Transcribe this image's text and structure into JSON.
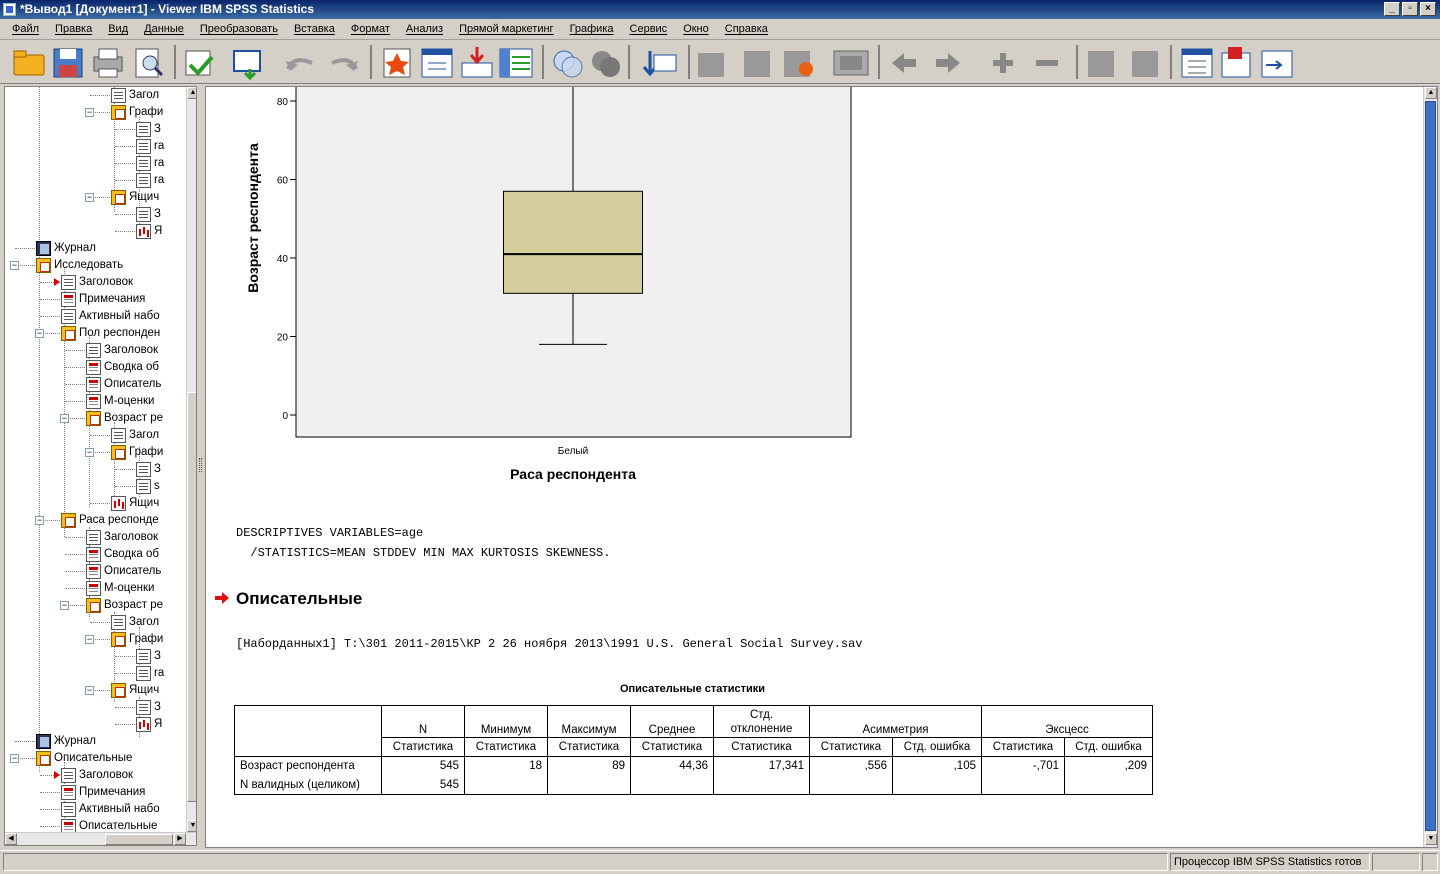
{
  "window": {
    "title": "*Вывод1 [Документ1] - Viewer IBM SPSS Statistics"
  },
  "menu": [
    "Файл",
    "Правка",
    "Вид",
    "Данные",
    "Преобразовать",
    "Вставка",
    "Формат",
    "Анализ",
    "Прямой маркетинг",
    "Графика",
    "Сервис",
    "Окно",
    "Справка"
  ],
  "toolbar": {
    "icons": [
      "open-icon",
      "save-icon",
      "print-icon",
      "print-preview-icon",
      "export-icon",
      "recall-dialog-icon",
      "undo-icon",
      "redo-icon",
      "goto-data-icon",
      "goto-case-icon",
      "goto-variable-icon",
      "variables-icon",
      "show-all-icon",
      "hide-icon",
      "designate-window-icon",
      "promote-icon",
      "demote-icon",
      "expand-icon",
      "collapse-icon",
      "show-icon",
      "hide-item-icon",
      "insert-heading-icon",
      "insert-title-icon",
      "insert-text-icon"
    ]
  },
  "outline": {
    "items": [
      {
        "label": "Загол",
        "y": 5,
        "indent": 110,
        "icon": "doc",
        "line": true
      },
      {
        "label": "Графи",
        "y": 22,
        "indent": 110,
        "icon": "folder",
        "pm": "-"
      },
      {
        "label": "З",
        "y": 39,
        "indent": 135,
        "icon": "doc"
      },
      {
        "label": "ra",
        "y": 56,
        "indent": 135,
        "icon": "doc"
      },
      {
        "label": "ra",
        "y": 73,
        "indent": 135,
        "icon": "doc"
      },
      {
        "label": "ra",
        "y": 90,
        "indent": 135,
        "icon": "doc"
      },
      {
        "label": "Ящич",
        "y": 107,
        "indent": 110,
        "icon": "folder",
        "pm": "-"
      },
      {
        "label": "З",
        "y": 124,
        "indent": 135,
        "icon": "doc"
      },
      {
        "label": "Я",
        "y": 141,
        "indent": 135,
        "icon": "chart"
      },
      {
        "label": "Журнал",
        "y": 158,
        "indent": 35,
        "icon": "book"
      },
      {
        "label": "Исследовать",
        "y": 175,
        "indent": 35,
        "icon": "folder",
        "pm": "-"
      },
      {
        "label": "Заголовок",
        "y": 192,
        "indent": 60,
        "icon": "doc",
        "arrow": true
      },
      {
        "label": "Примечания",
        "y": 209,
        "indent": 60,
        "icon": "table"
      },
      {
        "label": "Активный набо",
        "y": 226,
        "indent": 60,
        "icon": "doc"
      },
      {
        "label": "Пол респонден",
        "y": 243,
        "indent": 60,
        "icon": "folder",
        "pm": "-"
      },
      {
        "label": "Заголовок",
        "y": 260,
        "indent": 85,
        "icon": "doc"
      },
      {
        "label": "Сводка об",
        "y": 277,
        "indent": 85,
        "icon": "table"
      },
      {
        "label": "Описатель",
        "y": 294,
        "indent": 85,
        "icon": "table"
      },
      {
        "label": "М-оценки",
        "y": 311,
        "indent": 85,
        "icon": "table"
      },
      {
        "label": "Возраст ре",
        "y": 328,
        "indent": 85,
        "icon": "folder",
        "pm": "-"
      },
      {
        "label": "Загол",
        "y": 345,
        "indent": 110,
        "icon": "doc"
      },
      {
        "label": "Графи",
        "y": 362,
        "indent": 110,
        "icon": "folder",
        "pm": "-"
      },
      {
        "label": "З",
        "y": 379,
        "indent": 135,
        "icon": "doc"
      },
      {
        "label": "s",
        "y": 396,
        "indent": 135,
        "icon": "doc"
      },
      {
        "label": "Ящич",
        "y": 413,
        "indent": 110,
        "icon": "chart"
      },
      {
        "label": "Раса респонде",
        "y": 430,
        "indent": 60,
        "icon": "folder",
        "pm": "-"
      },
      {
        "label": "Заголовок",
        "y": 447,
        "indent": 85,
        "icon": "doc"
      },
      {
        "label": "Сводка об",
        "y": 464,
        "indent": 85,
        "icon": "table"
      },
      {
        "label": "Описатель",
        "y": 481,
        "indent": 85,
        "icon": "table"
      },
      {
        "label": "М-оценки",
        "y": 498,
        "indent": 85,
        "icon": "table"
      },
      {
        "label": "Возраст ре",
        "y": 515,
        "indent": 85,
        "icon": "folder",
        "pm": "-"
      },
      {
        "label": "Загол",
        "y": 532,
        "indent": 110,
        "icon": "doc"
      },
      {
        "label": "Графи",
        "y": 549,
        "indent": 110,
        "icon": "folder",
        "pm": "-"
      },
      {
        "label": "З",
        "y": 566,
        "indent": 135,
        "icon": "doc"
      },
      {
        "label": "ra",
        "y": 583,
        "indent": 135,
        "icon": "doc"
      },
      {
        "label": "Ящич",
        "y": 600,
        "indent": 110,
        "icon": "folder",
        "pm": "-"
      },
      {
        "label": "З",
        "y": 617,
        "indent": 135,
        "icon": "doc"
      },
      {
        "label": "Я",
        "y": 634,
        "indent": 135,
        "icon": "chart"
      },
      {
        "label": "Журнал",
        "y": 651,
        "indent": 35,
        "icon": "book"
      },
      {
        "label": "Описательные",
        "y": 668,
        "indent": 35,
        "icon": "folder",
        "pm": "-"
      },
      {
        "label": "Заголовок",
        "y": 685,
        "indent": 60,
        "icon": "doc",
        "arrow": true
      },
      {
        "label": "Примечания",
        "y": 702,
        "indent": 60,
        "icon": "table"
      },
      {
        "label": "Активный набо",
        "y": 719,
        "indent": 60,
        "icon": "doc"
      },
      {
        "label": "Описательные",
        "y": 736,
        "indent": 60,
        "icon": "table"
      }
    ]
  },
  "chart_data": {
    "type": "box",
    "categories": [
      "Белый"
    ],
    "boxes": [
      {
        "category": "Белый",
        "whisker_low": 18,
        "q1": 31,
        "median": 41,
        "q3": 57,
        "whisker_high": 89
      }
    ],
    "title": "",
    "xlabel": "Раса респондента",
    "ylabel": "Возраст респондента",
    "yticks": [
      0,
      20,
      40,
      60,
      80
    ],
    "colors": {
      "box_fill": "#d3ce9b",
      "plot_bg": "#f0f0f0"
    }
  },
  "syntax": {
    "line1": "DESCRIPTIVES VARIABLES=age",
    "line2": "  /STATISTICS=MEAN STDDEV MIN MAX KURTOSIS SKEWNESS."
  },
  "section": {
    "heading": "Описательные"
  },
  "dataset": {
    "text": "[Наборданных1] T:\\301 2011-2015\\КР 2 26 ноября 2013\\1991 U.S. General Social Survey.sav"
  },
  "table": {
    "title": "Описательные статистики",
    "headers": {
      "n": "N",
      "min": "Минимум",
      "max": "Максимум",
      "mean": "Среднее",
      "std": "Стд. отклонение",
      "skew": "Асимметрия",
      "kurt": "Эксцесс"
    },
    "subheaders": {
      "stat": "Статистика",
      "se": "Стд. ошибка"
    },
    "rows": [
      {
        "label": "Возраст респондента",
        "n": "545",
        "min": "18",
        "max": "89",
        "mean": "44,36",
        "std": "17,341",
        "skew": ",556",
        "skew_se": ",105",
        "kurt": "-,701",
        "kurt_se": ",209"
      },
      {
        "label": "N валидных (целиком)",
        "n": "545",
        "min": "",
        "max": "",
        "mean": "",
        "std": "",
        "skew": "",
        "skew_se": "",
        "kurt": "",
        "kurt_se": ""
      }
    ]
  },
  "status": {
    "processor": "Процессор IBM SPSS Statistics  готов"
  }
}
